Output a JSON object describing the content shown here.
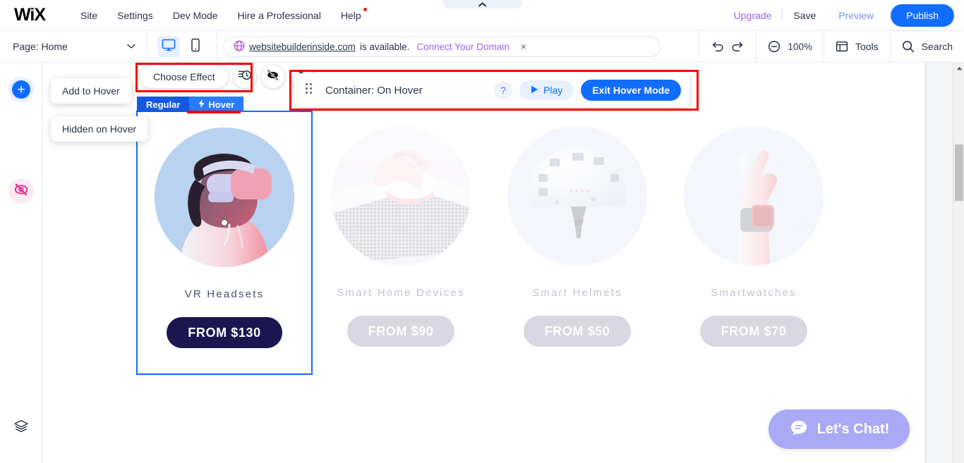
{
  "topbar": {
    "logo": "WiX",
    "nav": [
      {
        "label": "Site",
        "name": "site"
      },
      {
        "label": "Settings",
        "name": "settings"
      },
      {
        "label": "Dev Mode",
        "name": "dev-mode"
      },
      {
        "label": "Hire a Professional",
        "name": "hire-a-professional"
      },
      {
        "label": "Help",
        "name": "help",
        "badge": true
      }
    ],
    "upgrade": "Upgrade",
    "save": "Save",
    "preview": "Preview",
    "publish": "Publish",
    "accent": "#116dff",
    "upgrade_color": "#9a64e8"
  },
  "toolbar": {
    "page_label": "Page: Home",
    "domain_name": "websitebuilderinside.com",
    "domain_status": "is available.",
    "domain_cta": "Connect Your Domain",
    "domain_close": "×",
    "zoom": "100%",
    "tools_label": "Tools",
    "search_label": "Search"
  },
  "hover_tools": {
    "tooltip_add": "Add to Hover",
    "tooltip_hidden": "Hidden on Hover",
    "choose_effect": "Choose Effect",
    "tab_regular": "Regular",
    "tab_hover": "Hover",
    "bar_title": "Container: On Hover",
    "help": "?",
    "play": "Play",
    "exit": "Exit Hover Mode",
    "highlight_color": "#f50000"
  },
  "canvas": {
    "cards": [
      {
        "title": "VR Headsets",
        "price": "FROM $130",
        "image": "vr-headset-photo",
        "selected": true,
        "dim": false
      },
      {
        "title": "Smart Home Devices",
        "price": "FROM $90",
        "image": "smart-home-device-photo",
        "selected": false,
        "dim": true
      },
      {
        "title": "Smart Helmets",
        "price": "FROM $50",
        "image": "smart-helmet-photo",
        "selected": false,
        "dim": true
      },
      {
        "title": "Smartwatches",
        "price": "FROM $70",
        "image": "smartwatch-photo",
        "selected": false,
        "dim": true
      }
    ],
    "chat_label": "Let's Chat!"
  }
}
